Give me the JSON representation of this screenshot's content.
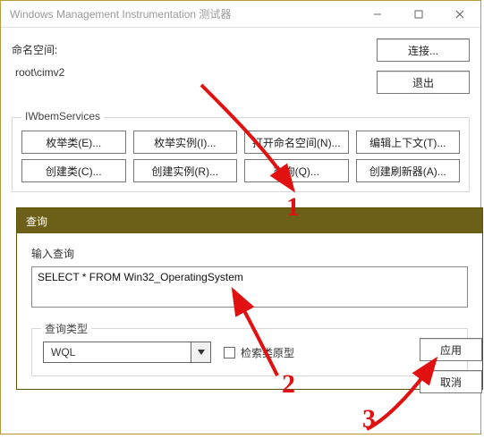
{
  "window": {
    "title": "Windows Management Instrumentation 测试器"
  },
  "namespace": {
    "label": "命名空间:",
    "value": "root\\cimv2"
  },
  "sidebuttons": {
    "connect": "连接...",
    "exit": "退出"
  },
  "services": {
    "legend": "IWbemServices",
    "row1": [
      "枚举类(E)...",
      "枚举实例(I)...",
      "打开命名空间(N)...",
      "编辑上下文(T)..."
    ],
    "row2": [
      "创建类(C)...",
      "创建实例(R)...",
      "查询(Q)...",
      "创建刷新器(A)..."
    ]
  },
  "dialog": {
    "title": "查询",
    "input_label": "输入查询",
    "query_value": "SELECT * FROM Win32_OperatingSystem",
    "type_legend": "查询类型",
    "combo_value": "WQL",
    "checkbox_label": "检索类原型",
    "apply": "应用",
    "cancel": "取消"
  },
  "annotations": {
    "n1": "1",
    "n2": "2",
    "n3": "3"
  }
}
